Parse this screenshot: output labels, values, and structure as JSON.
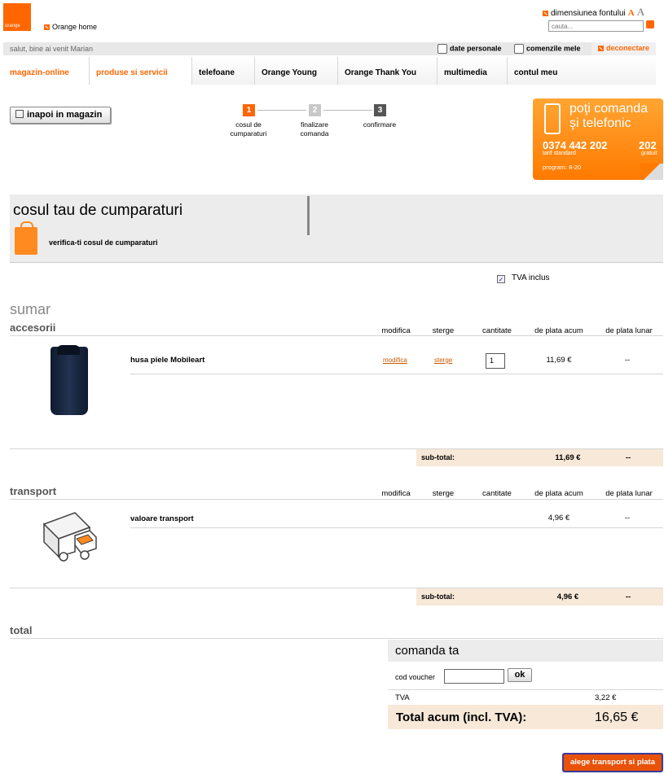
{
  "header": {
    "logo_text": "orange",
    "home_link": "Orange home",
    "font_size_label": "dimensiunea fontului",
    "font_small": "A",
    "font_large": "A",
    "search_placeholder": "cauta..."
  },
  "userbar": {
    "welcome": "salut, bine ai venit Marian",
    "personal_data": "date personale",
    "my_orders": "comenzile mele",
    "logout": "deconectare"
  },
  "nav": {
    "tabs": [
      {
        "label": "magazin-online"
      },
      {
        "label": "produse si servicii"
      },
      {
        "label": "telefoane"
      },
      {
        "label": "Orange Young"
      },
      {
        "label": "Orange Thank You"
      },
      {
        "label": "multimedia"
      },
      {
        "label": "contul meu"
      }
    ]
  },
  "back_button": "inapoi in magazin",
  "steps": [
    {
      "num": "1",
      "label": "cosul de cumparaturi",
      "color": "#ff6600"
    },
    {
      "num": "2",
      "label": "finalizare comanda",
      "color": "#c8c8c8"
    },
    {
      "num": "3",
      "label": "confirmare",
      "color": "#555555"
    }
  ],
  "promo": {
    "title": "poţi comanda şi telefonic",
    "number": "0374 442 202",
    "number_note": "tarif standard",
    "free_number": "202",
    "free_note": "gratuit",
    "hours": "program: 8-20"
  },
  "cart": {
    "title": "cosul tau de cumparaturi",
    "subtitle": "verifica-ti cosul de cumparaturi",
    "tva_label": "TVA inclus",
    "tva_checked": "✓",
    "summary_title": "sumar"
  },
  "columns": {
    "modify": "modifica",
    "delete": "sterge",
    "quantity": "cantitate",
    "pay_now": "de plata acum",
    "pay_monthly": "de plata lunar"
  },
  "accessories": {
    "title": "accesorii",
    "items": [
      {
        "name": "husa piele Mobileart",
        "modify": "modifica",
        "delete": "sterge",
        "quantity": "1",
        "pay_now": "11,69 €",
        "pay_monthly": "--"
      }
    ],
    "subtotal_label": "sub-total:",
    "subtotal_now": "11,69 €",
    "subtotal_monthly": "--"
  },
  "transport": {
    "title": "transport",
    "items": [
      {
        "name": "valoare transport",
        "pay_now": "4,96 €",
        "pay_monthly": "--"
      }
    ],
    "subtotal_label": "sub-total:",
    "subtotal_now": "4,96 €",
    "subtotal_monthly": "--"
  },
  "total": {
    "title": "total",
    "box_title": "comanda ta",
    "voucher_label": "cod voucher",
    "voucher_value": "",
    "ok_label": "ok",
    "tva_label": "TVA",
    "tva_value": "3,22 €",
    "total_label": "Total acum (incl. TVA):",
    "total_value": "16,65 €"
  },
  "checkout_button": "alege transport si plata",
  "colors": {
    "brand": "#ff6600",
    "subtotal_bg": "#f7e8d8"
  }
}
